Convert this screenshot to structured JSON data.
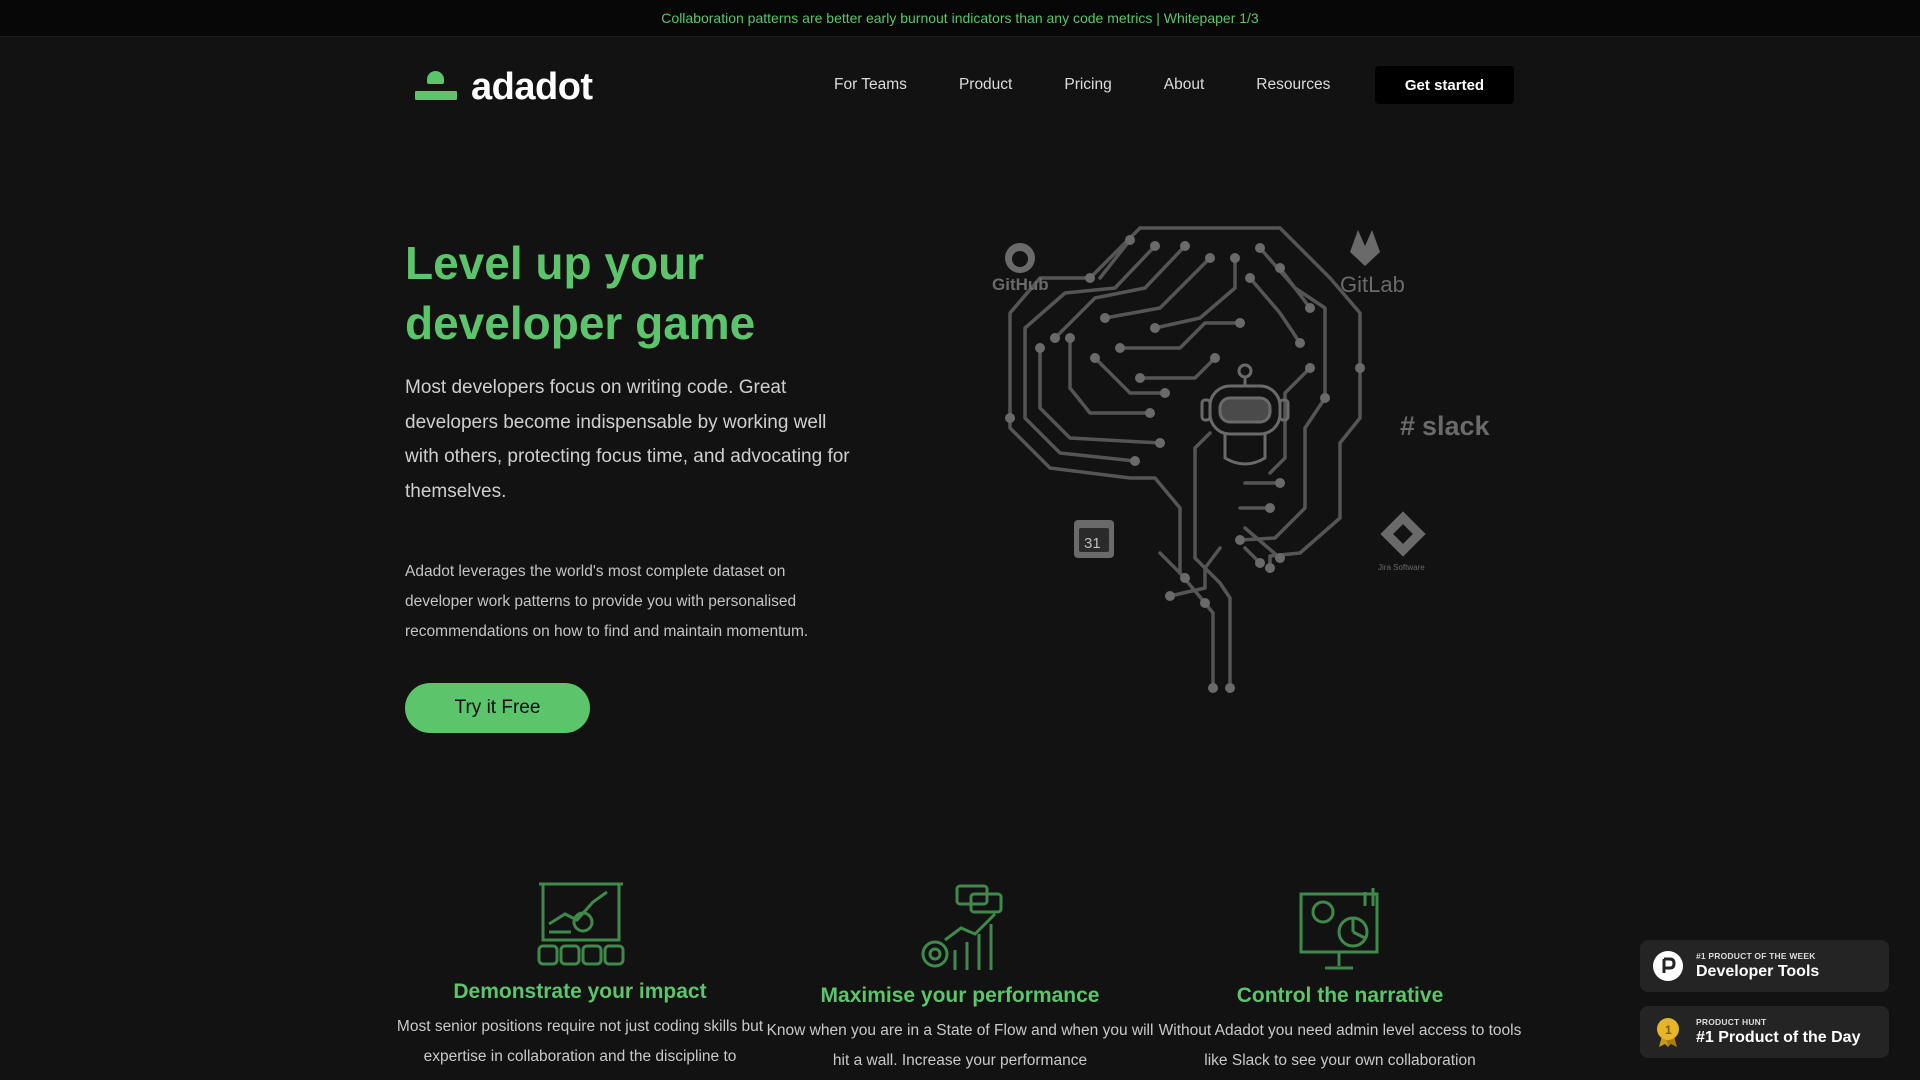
{
  "banner": {
    "text": "Collaboration patterns are better early burnout indicators than any code metrics | Whitepaper 1/3"
  },
  "nav": {
    "logo_text": "adadot",
    "links": [
      "For Teams",
      "Product",
      "Pricing",
      "About",
      "Resources"
    ],
    "cta_label": "Get started"
  },
  "hero": {
    "title_line1": "Level up your",
    "title_line2": "developer game",
    "paragraph1": "Most developers focus on writing code. Great developers become indispensable by working well with others, protecting focus time, and advocating for themselves.",
    "paragraph2": "Adadot leverages the world's most complete dataset on developer work patterns to provide you with personalised recommendations on how to find and maintain momentum.",
    "cta_label": "Try it Free",
    "integrations": {
      "github": "GitHub",
      "gitlab": "GitLab",
      "slack": "slack",
      "calendar": "31",
      "jira": "Jira Software"
    }
  },
  "features": [
    {
      "icon": "presentation-chart-icon",
      "title": "Demonstrate your impact",
      "text": "Most senior positions require not just coding skills but expertise in collaboration and the discipline to"
    },
    {
      "icon": "performance-graph-icon",
      "title": "Maximise your performance",
      "text": "Know when you are in a State of Flow and when you will hit a wall. Increase your performance"
    },
    {
      "icon": "dashboard-monitor-icon",
      "title": "Control the narrative",
      "text": "Without Adadot you need admin level access to tools like Slack to see your own collaboration"
    }
  ],
  "badges": [
    {
      "small": "#1 PRODUCT OF THE WEEK",
      "big": "Developer Tools",
      "icon": "product-hunt-icon"
    },
    {
      "small": "PRODUCT HUNT",
      "big": "#1 Product of the Day",
      "icon": "medal-icon",
      "medal_number": "1"
    }
  ],
  "colors": {
    "accent": "#5cc46a",
    "background": "#121212",
    "banner": "#070707"
  }
}
